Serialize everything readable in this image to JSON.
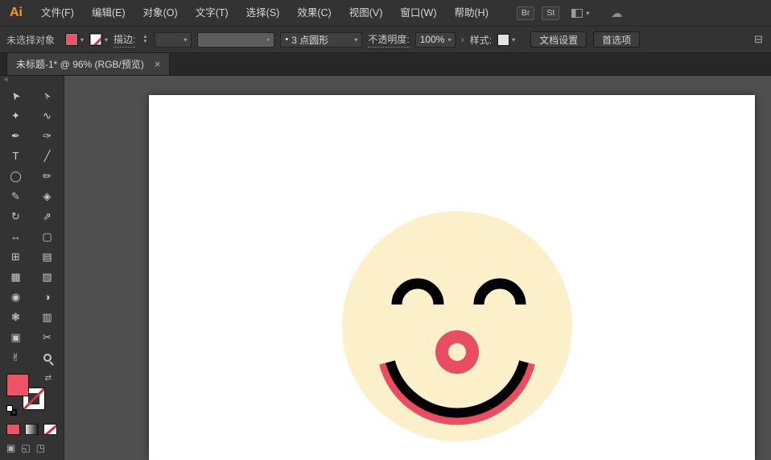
{
  "app": {
    "logo_text": "Ai"
  },
  "menu_bar": {
    "items": [
      {
        "label": "文件(F)"
      },
      {
        "label": "编辑(E)"
      },
      {
        "label": "对象(O)"
      },
      {
        "label": "文字(T)"
      },
      {
        "label": "选择(S)"
      },
      {
        "label": "效果(C)"
      },
      {
        "label": "视图(V)"
      },
      {
        "label": "窗口(W)"
      },
      {
        "label": "帮助(H)"
      }
    ],
    "bridge_label": "Br",
    "stock_label": "St"
  },
  "control_bar": {
    "status": "未选择对象",
    "stroke_label": "描边:",
    "stroke_value": "",
    "brush_name": "3 点圆形",
    "opacity_label": "不透明度:",
    "opacity_value": "100%",
    "style_label": "样式:",
    "doc_setup": "文档设置",
    "preferences": "首选项"
  },
  "tab_bar": {
    "doc_title": "未标题-1* @ 96% (RGB/预览)"
  },
  "icons": {
    "caret": "▾",
    "stepper_up": "▴",
    "stepper_down": "▾",
    "chevron": "›",
    "close": "×",
    "bullet": "•",
    "collapse": "«",
    "swap": "⇄",
    "dock": "⊟",
    "cloud": "☁",
    "draw_normal": "▣",
    "draw_behind": "◱",
    "draw_inside": "◳"
  },
  "tools_panel": {
    "tools": [
      {
        "name": "selection",
        "glyph": "➤"
      },
      {
        "name": "direct-selection",
        "glyph": "➢"
      },
      {
        "name": "magic-wand",
        "glyph": "✦"
      },
      {
        "name": "lasso",
        "glyph": "∿"
      },
      {
        "name": "pen",
        "glyph": "✒"
      },
      {
        "name": "curvature",
        "glyph": "✑"
      },
      {
        "name": "type",
        "glyph": "T"
      },
      {
        "name": "line-segment",
        "glyph": "╱"
      },
      {
        "name": "ellipse",
        "glyph": "◯"
      },
      {
        "name": "paintbrush",
        "glyph": "✏"
      },
      {
        "name": "pencil",
        "glyph": "✎"
      },
      {
        "name": "eraser",
        "glyph": "◈"
      },
      {
        "name": "rotate",
        "glyph": "↻"
      },
      {
        "name": "scale",
        "glyph": "⇗"
      },
      {
        "name": "width",
        "glyph": "↔"
      },
      {
        "name": "free-transform",
        "glyph": "▢"
      },
      {
        "name": "shape-builder",
        "glyph": "⊞"
      },
      {
        "name": "perspective-grid",
        "glyph": "▤"
      },
      {
        "name": "mesh",
        "glyph": "▦"
      },
      {
        "name": "gradient",
        "glyph": "▧"
      },
      {
        "name": "eyedropper",
        "glyph": "◉"
      },
      {
        "name": "blend",
        "glyph": "◑"
      },
      {
        "name": "symbol-sprayer",
        "glyph": "❃"
      },
      {
        "name": "column-graph",
        "glyph": "▥"
      },
      {
        "name": "artboard",
        "glyph": "▣"
      },
      {
        "name": "slice",
        "glyph": "✂"
      },
      {
        "name": "hand",
        "glyph": "✌"
      },
      {
        "name": "zoom",
        "glyph": ""
      }
    ]
  },
  "colors": {
    "fill_pink": "#ee5266",
    "face_cream": "#fcf0cb",
    "canvas_gray": "#4f4f4f"
  },
  "artwork": {
    "face_fill": "#fcf0cb",
    "eye_stroke": "#000000",
    "smile_stroke": "#000000",
    "accent_pink": "#e94d61"
  }
}
